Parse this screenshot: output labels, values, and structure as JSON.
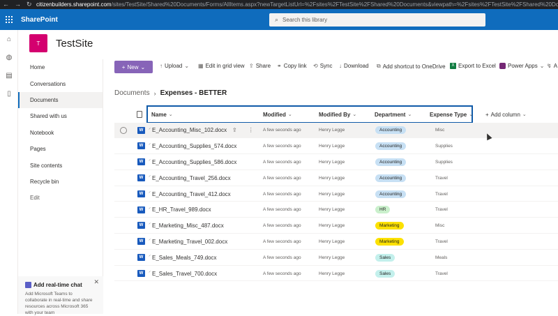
{
  "browser": {
    "nav": [
      "←",
      "→",
      "↻"
    ],
    "url_domain": "citizenbuilders.sharepoint.com",
    "url_rest": "/sites/TestSite/Shared%20Documents/Forms/AllItems.aspx?newTargetListUrl=%2Fsites%2FTestSite%2FShared%20Documents&viewpath=%2Fsites%2FTestSite%2FShared%20Documents"
  },
  "suite": {
    "app_name": "SharePoint",
    "search_placeholder": "Search this library"
  },
  "site": {
    "logo_letter": "T",
    "logo_color": "#d4006f",
    "title": "TestSite"
  },
  "leftnav": {
    "items": [
      {
        "label": "Home"
      },
      {
        "label": "Conversations"
      },
      {
        "label": "Documents"
      },
      {
        "label": "Shared with us"
      },
      {
        "label": "Notebook"
      },
      {
        "label": "Pages"
      },
      {
        "label": "Site contents"
      },
      {
        "label": "Recycle bin"
      },
      {
        "label": "Edit"
      }
    ],
    "active_index": 2
  },
  "chat_card": {
    "title": "Add real-time chat",
    "body": "Add Microsoft Teams to collaborate in real-time and share resources across Microsoft 365 with your team"
  },
  "cmdbar": {
    "new_label": "New",
    "upload": "Upload",
    "edit_grid": "Edit in grid view",
    "share": "Share",
    "copy_link": "Copy link",
    "sync": "Sync",
    "download": "Download",
    "add_shortcut": "Add shortcut to OneDrive",
    "export_excel": "Export to Excel",
    "power_apps": "Power Apps",
    "automate": "A"
  },
  "breadcrumb": {
    "root": "Documents",
    "current": "Expenses - BETTER"
  },
  "columns": {
    "name": "Name",
    "modified": "Modified",
    "modified_by": "Modified By",
    "department": "Department",
    "expense_type": "Expense Type",
    "add_column": "Add column"
  },
  "rows": [
    {
      "name": "E_Accounting_Misc_102.docx",
      "modified": "A few seconds ago",
      "by": "Henry Legge",
      "dept": "Accounting",
      "type": "Misc"
    },
    {
      "name": "E_Accounting_Supplies_574.docx",
      "modified": "A few seconds ago",
      "by": "Henry Legge",
      "dept": "Accounting",
      "type": "Supplies"
    },
    {
      "name": "E_Accounting_Supplies_586.docx",
      "modified": "A few seconds ago",
      "by": "Henry Legge",
      "dept": "Accounting",
      "type": "Supplies"
    },
    {
      "name": "E_Accounting_Travel_256.docx",
      "modified": "A few seconds ago",
      "by": "Henry Legge",
      "dept": "Accounting",
      "type": "Travel"
    },
    {
      "name": "E_Accounting_Travel_412.docx",
      "modified": "A few seconds ago",
      "by": "Henry Legge",
      "dept": "Accounting",
      "type": "Travel"
    },
    {
      "name": "E_HR_Travel_989.docx",
      "modified": "A few seconds ago",
      "by": "Henry Legge",
      "dept": "HR",
      "type": "Travel"
    },
    {
      "name": "E_Marketing_Misc_487.docx",
      "modified": "A few seconds ago",
      "by": "Henry Legge",
      "dept": "Marketing",
      "type": "Misc"
    },
    {
      "name": "E_Marketing_Travel_002.docx",
      "modified": "A few seconds ago",
      "by": "Henry Legge",
      "dept": "Marketing",
      "type": "Travel"
    },
    {
      "name": "E_Sales_Meals_749.docx",
      "modified": "A few seconds ago",
      "by": "Henry Legge",
      "dept": "Sales",
      "type": "Meals"
    },
    {
      "name": "E_Sales_Travel_700.docx",
      "modified": "A few seconds ago",
      "by": "Henry Legge",
      "dept": "Sales",
      "type": "Travel"
    }
  ],
  "dept_colors": {
    "Accounting": "#c7e0f4",
    "HR": "#caf0cc",
    "Marketing": "#fce100",
    "Sales": "#c3f0ec"
  },
  "colors": {
    "suite_bar": "#0f6cbd",
    "new_button": "#8764b8",
    "header_highlight": "#0f5aa8"
  }
}
